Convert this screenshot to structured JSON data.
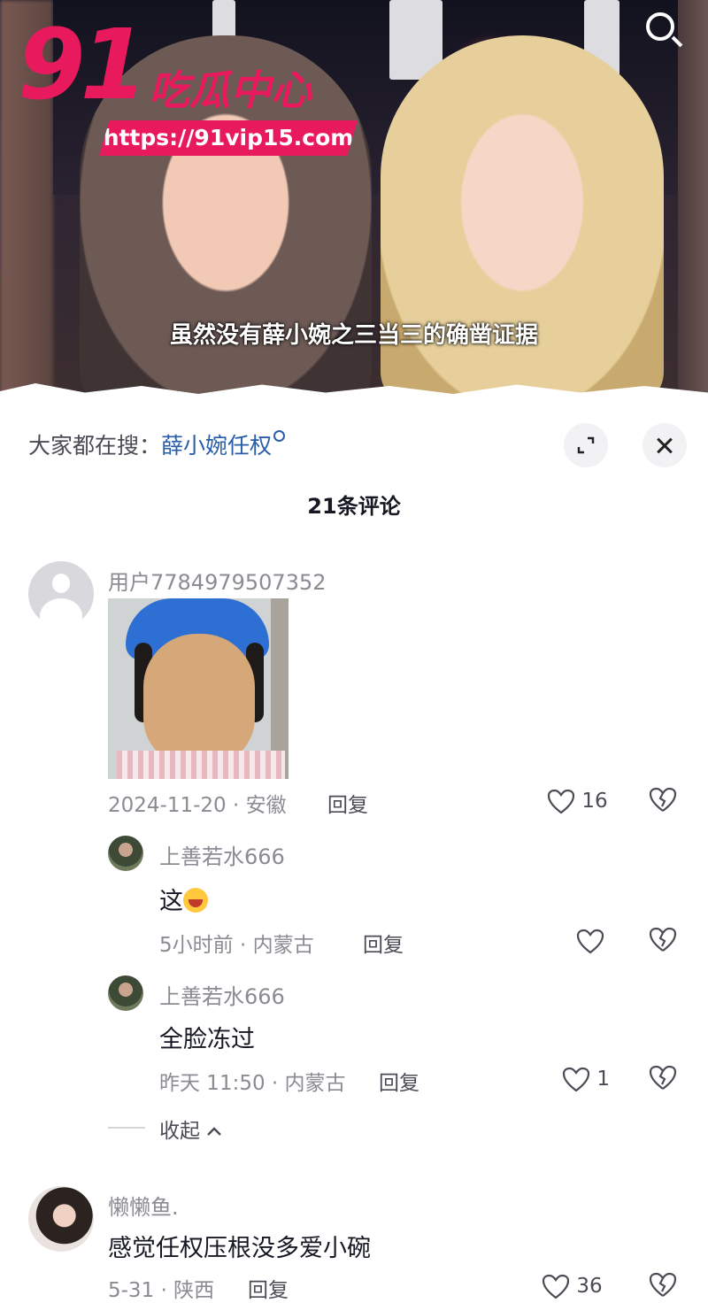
{
  "watermark": {
    "number": "91",
    "name": "吃瓜中心",
    "url": "https://91vip15.com"
  },
  "video": {
    "caption": "虽然没有薛小婉之三当三的确凿证据"
  },
  "panel": {
    "hot_search_label": "大家都在搜：",
    "hot_search_keyword": "薛小婉任权",
    "comment_count": "21条评论"
  },
  "comments": [
    {
      "username": "用户7784979507352",
      "image": "photo of a woman with a blue hair cap",
      "meta": "2024-11-20 · 安徽",
      "reply": "回复",
      "likes": "16",
      "replies": [
        {
          "username": "上善若水666",
          "text": "这",
          "meta": "5小时前 · 内蒙古",
          "reply": "回复",
          "likes": ""
        },
        {
          "username": "上善若水666",
          "text": "全脸冻过",
          "meta": "昨天 11:50 · 内蒙古",
          "reply": "回复",
          "likes": "1"
        }
      ],
      "collapse": "收起"
    },
    {
      "username": "懒懒鱼.",
      "text": "感觉任权压根没多爱小碗",
      "meta": "5-31 · 陕西",
      "reply": "回复",
      "likes": "36"
    }
  ],
  "icons": {
    "search": "search-icon",
    "expand": "expand-icon",
    "close": "close-icon",
    "like": "heart-icon",
    "dislike": "broken-heart-icon",
    "collapse": "chevron-up-icon"
  },
  "colors": {
    "brand": "#e8195d",
    "keyword": "#2a5da8",
    "muted": "#8b8b93"
  }
}
